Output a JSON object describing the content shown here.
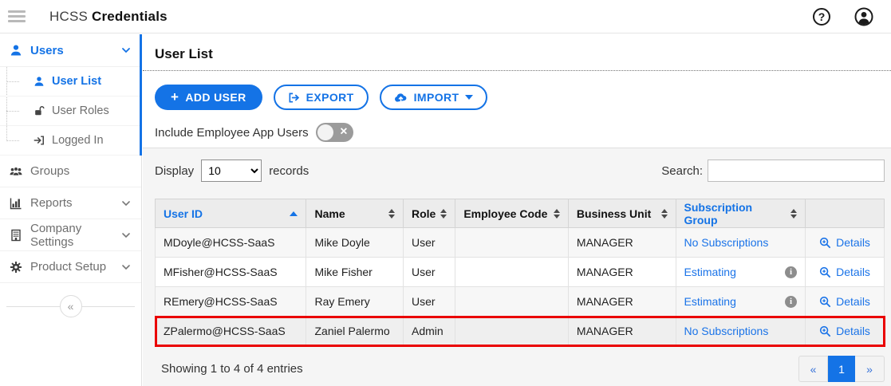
{
  "topbar": {
    "brand_regular": "HCSS",
    "brand_bold": "Credentials",
    "help_glyph": "?"
  },
  "sidebar": {
    "users_label": "Users",
    "sub_items": [
      {
        "label": "User List"
      },
      {
        "label": "User Roles"
      },
      {
        "label": "Logged In"
      }
    ],
    "items": [
      {
        "label": "Groups"
      },
      {
        "label": "Reports"
      },
      {
        "label": "Company Settings"
      },
      {
        "label": "Product Setup"
      }
    ],
    "collapse_glyph": "«"
  },
  "main": {
    "page_title": "User List",
    "add_user_plus": "+",
    "add_user_label": "ADD USER",
    "export_label": "EXPORT",
    "import_label": "IMPORT",
    "toggle_label": "Include Employee App Users",
    "toggle_off_glyph": "×",
    "display_label": "Display",
    "display_value": "10",
    "records_label": "records",
    "search_label": "Search:",
    "table": {
      "headers": [
        "User ID",
        "Name",
        "Role",
        "Employee Code",
        "Business Unit",
        "Subscription Group"
      ],
      "info_glyph": "i",
      "rows": [
        {
          "user_id": "MDoyle@HCSS-SaaS",
          "name": "Mike Doyle",
          "role": "User",
          "employee_code": "",
          "business_unit": "MANAGER",
          "subscription_group": "No Subscriptions",
          "details": "Details"
        },
        {
          "user_id": "MFisher@HCSS-SaaS",
          "name": "Mike Fisher",
          "role": "User",
          "employee_code": "",
          "business_unit": "MANAGER",
          "subscription_group": "Estimating",
          "details": "Details"
        },
        {
          "user_id": "REmery@HCSS-SaaS",
          "name": "Ray Emery",
          "role": "User",
          "employee_code": "",
          "business_unit": "MANAGER",
          "subscription_group": "Estimating",
          "details": "Details"
        },
        {
          "user_id": "ZPalermo@HCSS-SaaS",
          "name": "Zaniel Palermo",
          "role": "Admin",
          "employee_code": "",
          "business_unit": "MANAGER",
          "subscription_group": "No Subscriptions",
          "details": "Details"
        }
      ]
    },
    "footer_text": "Showing 1 to 4 of 4 entries",
    "pagination": {
      "prev": "«",
      "page": "1",
      "next": "»"
    }
  },
  "colors": {
    "accent": "#1473e6",
    "link": "#1a73e8",
    "highlight_border": "#ea0000",
    "toggle_off": "#9b9b9b"
  }
}
